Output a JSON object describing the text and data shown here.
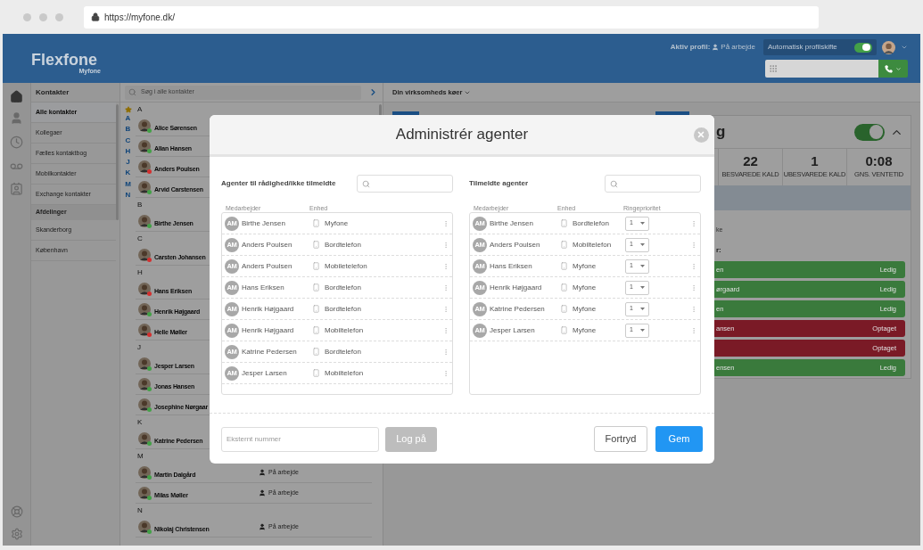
{
  "browser": {
    "url": "https://myfone.dk/"
  },
  "header": {
    "logo": "Flexfone",
    "logo_sub": "Myfone",
    "profile_label": "Aktiv profil:",
    "profile_value": "På arbejde",
    "auto_switch": {
      "label": "Automatisk profilskifte",
      "on": true
    }
  },
  "contact_groups": {
    "title": "Kontakter",
    "items": [
      {
        "label": "Alle kontakter",
        "selected": true
      },
      {
        "label": "Kollegaer",
        "selected": false
      },
      {
        "label": "Fælles kontaktbog",
        "selected": false
      },
      {
        "label": "Mobilkontakter",
        "selected": false
      },
      {
        "label": "Exchange kontakter",
        "selected": false
      }
    ],
    "departments": {
      "title": "Afdelinger",
      "items": [
        {
          "label": "Skanderborg",
          "selected": false
        },
        {
          "label": "København",
          "selected": false
        }
      ]
    }
  },
  "contacts": {
    "search_placeholder": "Søg i alle kontakter",
    "index": [
      "A",
      "B",
      "C",
      "H",
      "J",
      "K",
      "M",
      "N"
    ],
    "groups": [
      {
        "letter": "A",
        "contacts": [
          {
            "name": "Alice Sørensen",
            "color": "#43a047"
          },
          {
            "name": "Allan Hansen",
            "color": "#43a047"
          },
          {
            "name": "Anders Poulsen",
            "color": "#d32f2f"
          },
          {
            "name": "Arvid Carstensen",
            "color": "#43a047"
          }
        ]
      },
      {
        "letter": "B",
        "contacts": [
          {
            "name": "Birthe Jensen",
            "color": "#43a047"
          }
        ]
      },
      {
        "letter": "C",
        "contacts": [
          {
            "name": "Carsten Johansen",
            "color": "#d32f2f"
          }
        ]
      },
      {
        "letter": "H",
        "contacts": [
          {
            "name": "Hans Eriksen",
            "color": "#d32f2f"
          },
          {
            "name": "Henrik Højgaard",
            "color": "#43a047"
          },
          {
            "name": "Helle Møller",
            "color": "#d32f2f"
          }
        ]
      },
      {
        "letter": "J",
        "contacts": [
          {
            "name": "Jesper Larsen",
            "color": "#43a047"
          },
          {
            "name": "Jonas Hansen",
            "color": "#43a047"
          },
          {
            "name": "Josephine Nørgaar",
            "color": "#43a047"
          }
        ]
      },
      {
        "letter": "K",
        "contacts": [
          {
            "name": "Katrine Pedersen",
            "color": "#43a047"
          }
        ]
      },
      {
        "letter": "M",
        "contacts": [
          {
            "name": "Martin Dalgård",
            "color": "#43a047",
            "status": "På arbejde"
          },
          {
            "name": "Milas Møller",
            "color": "#43a047",
            "status": "På arbejde"
          }
        ]
      },
      {
        "letter": "N",
        "contacts": [
          {
            "name": "Nikolaj Christensen",
            "color": "#43a047",
            "status": "På arbejde"
          }
        ]
      }
    ]
  },
  "queues": {
    "title": "Din virksomheds køer",
    "card": {
      "title_fragment": "g",
      "on": true,
      "stats": [
        {
          "value": "22",
          "label": "BESVAREDE KALD"
        },
        {
          "value": "1",
          "label": "UBESVAREDE KALD"
        },
        {
          "value": "0:08",
          "label": "GNS. VENTETID"
        }
      ],
      "note_fragment": "ke",
      "agents_label_fragment": "r:",
      "agents": [
        {
          "name": "en",
          "status": "Ledig",
          "color": "#3a7a3c"
        },
        {
          "name": "ørgaard",
          "status": "Ledig",
          "color": "#3a7a3c"
        },
        {
          "name": "en",
          "status": "Ledig",
          "color": "#3a7a3c"
        },
        {
          "name": "ansen",
          "status": "Optaget",
          "color": "#7a1a26"
        },
        {
          "status": "Optaget",
          "color": "#7a1a26"
        },
        {
          "name": "ensen",
          "status": "Ledig",
          "color": "#3a7a3c"
        }
      ]
    }
  },
  "dialog": {
    "title": "Administrér agenter",
    "available": {
      "title": "Agenter til rådighed/ikke tilmeldte",
      "columns": [
        "Medarbejder",
        "Enhed"
      ],
      "rows": [
        {
          "initials": "AM",
          "name": "Birthe Jensen",
          "device": "Myfone"
        },
        {
          "initials": "AM",
          "name": "Anders Poulsen",
          "device": "Bordtelefon"
        },
        {
          "initials": "AM",
          "name": "Anders Poulsen",
          "device": "Mobiletelefon"
        },
        {
          "initials": "AM",
          "name": "Hans Eriksen",
          "device": "Bordtelefon"
        },
        {
          "initials": "AM",
          "name": "Henrik Højgaard",
          "device": "Bordtelefon"
        },
        {
          "initials": "AM",
          "name": "Henrik Højgaard",
          "device": "Mobiltelefon"
        },
        {
          "initials": "AM",
          "name": "Katrine Pedersen",
          "device": "Bordtelefon"
        },
        {
          "initials": "AM",
          "name": "Jesper Larsen",
          "device": "Mobiltelefon"
        }
      ]
    },
    "enrolled": {
      "title": "Tilmeldte agenter",
      "columns": [
        "Medarbejder",
        "Enhed",
        "Ringeprioritet"
      ],
      "rows": [
        {
          "initials": "AM",
          "name": "Birthe Jensen",
          "device": "Bordtelefon",
          "priority": "1"
        },
        {
          "initials": "AM",
          "name": "Anders Poulsen",
          "device": "Mobiltelefon",
          "priority": "1"
        },
        {
          "initials": "AM",
          "name": "Hans Eriksen",
          "device": "Myfone",
          "priority": "1"
        },
        {
          "initials": "AM",
          "name": "Henrik Højgaard",
          "device": "Myfone",
          "priority": "1"
        },
        {
          "initials": "AM",
          "name": "Katrine Pedersen",
          "device": "Myfone",
          "priority": "1"
        },
        {
          "initials": "AM",
          "name": "Jesper Larsen",
          "device": "Myfone",
          "priority": "1"
        }
      ]
    },
    "external_number": {
      "placeholder": "Eksternt nummer"
    },
    "login_button": {
      "label": "Log på",
      "disabled": true
    },
    "buttons": [
      {
        "label": "Fortryd",
        "kind": "secondary"
      },
      {
        "label": "Gem",
        "kind": "primary"
      }
    ]
  }
}
